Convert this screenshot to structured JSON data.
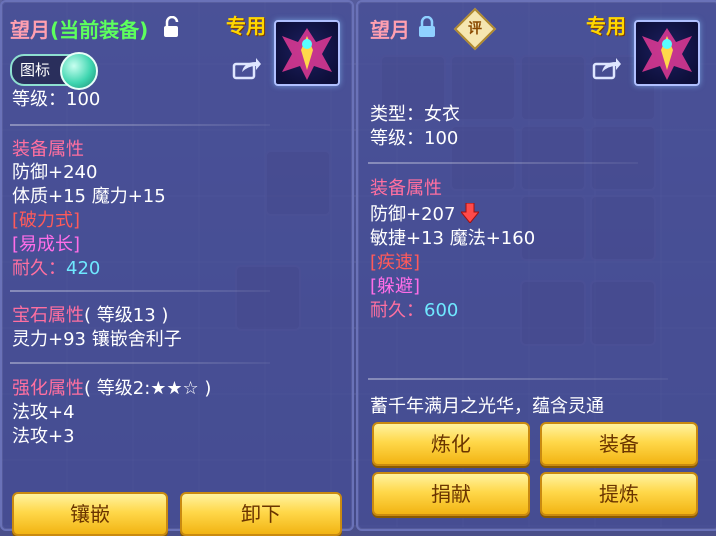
{
  "left_panel": {
    "title": "望月",
    "title_status": "(当前装备)",
    "exclusive": "专用",
    "toggle_label": "图标",
    "level": "等级：100",
    "equip_attr_header": "装备属性",
    "defense": "防御+240",
    "stat_line": "体质+15 魔力+15",
    "special1": "[破力式]",
    "special2": "[易成长]",
    "durability_label": "耐久：",
    "durability_value": "420",
    "gem_header": "宝石属性",
    "gem_level": "( 等级13 )",
    "gem_line": "灵力+93 镶嵌舍利子",
    "enhance_header": "强化属性",
    "enhance_level": "( 等级2:★★☆ )",
    "enhance1": "法攻+4",
    "enhance2": "法攻+3",
    "btn_inlay": "镶嵌",
    "btn_unequip": "卸下"
  },
  "right_panel": {
    "title": "望月",
    "rating_badge": "评",
    "exclusive": "专用",
    "type": "类型：女衣",
    "level": "等级：100",
    "equip_attr_header": "装备属性",
    "defense": "防御+207",
    "stat_line": "敏捷+13 魔法+160",
    "special1": "[疾速]",
    "special2": "[躲避]",
    "durability_label": "耐久：",
    "durability_value": "600",
    "description": "蓄千年满月之光华，蕴含灵通",
    "btn_refine": "炼化",
    "btn_equip": "装备",
    "btn_donate": "捐献",
    "btn_extract": "提炼"
  },
  "colors": {
    "title_pink": "#ff9fb0",
    "status_green": "#5dff5d",
    "section_pink": "#ff6fa0",
    "special_red": "#ff5a5a",
    "special_magenta": "#ff6ee8",
    "durability_cyan": "#6fe8ff",
    "button_gold": "#ffd84a"
  },
  "icons": {
    "unlock": "unlock-icon",
    "lock": "lock-icon",
    "share": "share-icon",
    "down_arrow": "arrow-down-icon"
  }
}
